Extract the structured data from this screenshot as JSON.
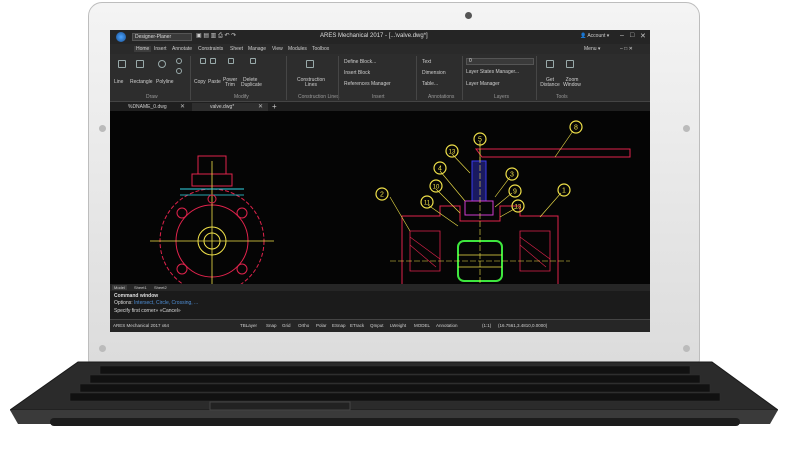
{
  "app": {
    "workspace_select": "Designer-Planer",
    "window_title": "ARES Mechanical 2017 - [...\\valve.dwg*]",
    "account_label": "Account",
    "menu_label": "Menu",
    "status_version": "ARES Mechanical 2017 x64"
  },
  "menu": {
    "items": [
      "Home",
      "Insert",
      "Annotate",
      "Constraints",
      "Sheet",
      "Manage",
      "View",
      "Modules",
      "Toolbox"
    ]
  },
  "ribbon": {
    "draw_buttons": [
      "Line",
      "Rectangle",
      "Polyline"
    ],
    "modify_buttons": [
      "Copy",
      "Paste",
      "Power Trim",
      "Delete",
      "Duplicate"
    ],
    "construction_button": "Construction Lines",
    "insert_buttons": [
      "Define Block...",
      "Insert Block",
      "References Manager"
    ],
    "annotation_buttons": [
      "Text",
      "Dimension",
      "Table..."
    ],
    "layer_buttons": [
      "Layer States Manager...",
      "Layer Manager"
    ],
    "layer_field": "0",
    "tool_buttons": [
      "Get Distance",
      "Zoom Window"
    ],
    "groups": [
      "Draw",
      "Modify",
      "Construction Lines",
      "Insert",
      "Annotations",
      "Layers",
      "Tools"
    ]
  },
  "doc_tabs": [
    {
      "label": "%DNAME_0.dwg"
    },
    {
      "label": "valve.dwg*"
    }
  ],
  "balloons": [
    "8",
    "5",
    "13",
    "4",
    "3",
    "10",
    "9",
    "11",
    "13",
    "2",
    "1"
  ],
  "layout_tabs": [
    "Model",
    "Sheet1",
    "Sheet2"
  ],
  "command": {
    "header": "Command window",
    "options_label": "Options:",
    "options_text": "Intersect, Circle, Crossing, ...",
    "line_last": "Specify first corner» «Cancel»"
  },
  "status": {
    "toggles": [
      "TBLayer",
      "Snap",
      "Grid",
      "Ortho",
      "Polar",
      "ESnap",
      "ETrack",
      "QInput",
      "LWeight",
      "MODEL"
    ],
    "annotation": "Annotation",
    "scale": "(1:1)",
    "coords": "(16.7561,3.4810,0.0000)"
  },
  "colors": {
    "accent": "#3a7bd5",
    "balloon": "#f0e14a",
    "drawing_red": "#e0234c",
    "drawing_green": "#3ee63e",
    "drawing_cyan": "#32d7e6",
    "drawing_yellow": "#f2e34a",
    "drawing_magenta": "#d03bd0"
  }
}
